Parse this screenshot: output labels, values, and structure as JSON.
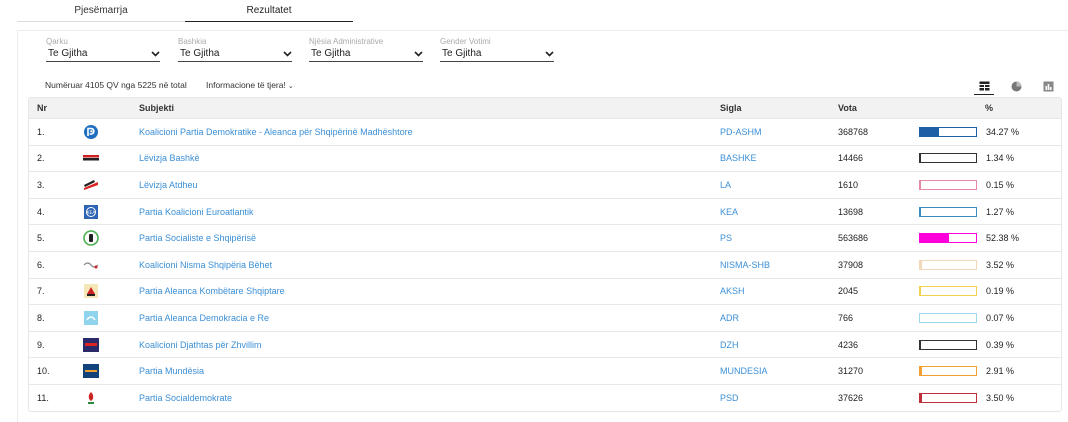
{
  "tabs": [
    {
      "label": "Pjesëmarrja",
      "active": false
    },
    {
      "label": "Rezultatet",
      "active": true
    }
  ],
  "filters": [
    {
      "label": "Qarku",
      "value": "Te Gjitha"
    },
    {
      "label": "Bashkia",
      "value": "Te Gjitha"
    },
    {
      "label": "Njësia Administrative",
      "value": "Te Gjitha"
    },
    {
      "label": "Gender Votimi",
      "value": "Te Gjitha"
    }
  ],
  "count_text": "Numëruar 4105 QV nga 5225 në total",
  "info_link": "Informacione të tjera!",
  "view_icons": [
    "table-view-icon",
    "pie-chart-icon",
    "bar-chart-icon"
  ],
  "table": {
    "headers": {
      "nr": "Nr",
      "subjekti": "Subjekti",
      "sigla": "Sigla",
      "vota": "Vota",
      "pct": "%"
    },
    "rows": [
      {
        "nr": "1.",
        "subjekti": "Koalicioni Partia Demokratike - Aleanca për Shqipërinë Madhështore",
        "sigla": "PD-ASHM",
        "vota": "368768",
        "pct": "34.27 %",
        "fill": 0.3427,
        "color": "#1f5fa6",
        "logo": "pd-logo-icon"
      },
      {
        "nr": "2.",
        "subjekti": "Lëvizja Bashkë",
        "sigla": "BASHKE",
        "vota": "14466",
        "pct": "1.34 %",
        "fill": 0.0134,
        "color": "#333333",
        "logo": "bashke-logo-icon"
      },
      {
        "nr": "3.",
        "subjekti": "Lëvizja Atdheu",
        "sigla": "LA",
        "vota": "1610",
        "pct": "0.15 %",
        "fill": 0.0015,
        "color": "#e58aa0",
        "logo": "la-logo-icon"
      },
      {
        "nr": "4.",
        "subjekti": "Partia Koalicioni Euroatlantik",
        "sigla": "KEA",
        "vota": "13698",
        "pct": "1.27 %",
        "fill": 0.0127,
        "color": "#3b8bb8",
        "logo": "kea-logo-icon"
      },
      {
        "nr": "5.",
        "subjekti": "Partia Socialiste e Shqipërisë",
        "sigla": "PS",
        "vota": "563686",
        "pct": "52.38 %",
        "fill": 0.5238,
        "color": "#ff00dd",
        "logo": "ps-logo-icon"
      },
      {
        "nr": "6.",
        "subjekti": "Koalicioni Nisma Shqipëria Bëhet",
        "sigla": "NISMA-SHB",
        "vota": "37908",
        "pct": "3.52 %",
        "fill": 0.0352,
        "color": "#f0d9b8",
        "logo": "nisma-logo-icon"
      },
      {
        "nr": "7.",
        "subjekti": "Partia Aleanca Kombëtare Shqiptare",
        "sigla": "AKSH",
        "vota": "2045",
        "pct": "0.19 %",
        "fill": 0.0019,
        "color": "#f2d24a",
        "logo": "aksh-logo-icon"
      },
      {
        "nr": "8.",
        "subjekti": "Partia Aleanca Demokracia e Re",
        "sigla": "ADR",
        "vota": "766",
        "pct": "0.07 %",
        "fill": 0.0007,
        "color": "#9fd8ee",
        "logo": "adr-logo-icon"
      },
      {
        "nr": "9.",
        "subjekti": "Koalicioni Djathtas për Zhvillim",
        "sigla": "DZH",
        "vota": "4236",
        "pct": "0.39 %",
        "fill": 0.0039,
        "color": "#333333",
        "logo": "dzh-logo-icon"
      },
      {
        "nr": "10.",
        "subjekti": "Partia Mundësia",
        "sigla": "MUNDESIA",
        "vota": "31270",
        "pct": "2.91 %",
        "fill": 0.0291,
        "color": "#f0a030",
        "logo": "mundesia-logo-icon"
      },
      {
        "nr": "11.",
        "subjekti": "Partia Socialdemokrate",
        "sigla": "PSD",
        "vota": "37626",
        "pct": "3.50 %",
        "fill": 0.035,
        "color": "#c0303a",
        "logo": "psd-logo-icon"
      }
    ]
  }
}
